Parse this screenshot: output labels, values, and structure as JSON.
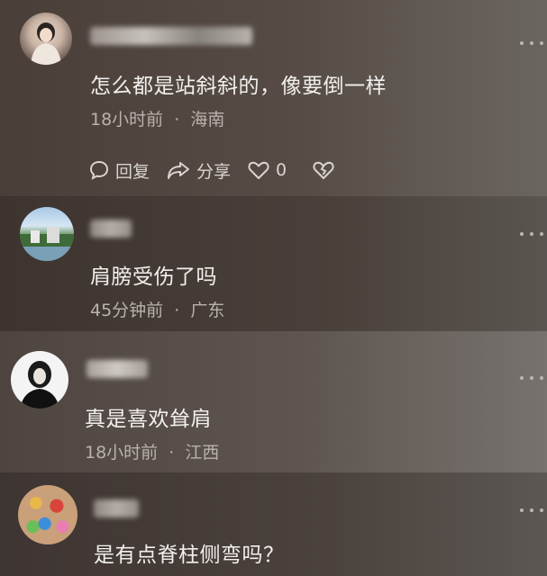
{
  "comments": [
    {
      "text": "怎么都是站斜斜的，像要倒一样",
      "time": "18小时前",
      "location": "海南",
      "actions": {
        "reply": "回复",
        "share": "分享",
        "like_count": "0"
      }
    },
    {
      "text": "肩膀受伤了吗",
      "time": "45分钟前",
      "location": "广东"
    },
    {
      "text": "真是喜欢耸肩",
      "time": "18小时前",
      "location": "江西"
    },
    {
      "text": "是有点脊柱侧弯吗？"
    }
  ],
  "meta_separator": "·",
  "icons": {
    "more": "more-dots-icon",
    "reply": "speech-bubble-icon",
    "share": "share-arrow-icon",
    "like": "heart-icon",
    "dislike": "broken-heart-icon"
  }
}
